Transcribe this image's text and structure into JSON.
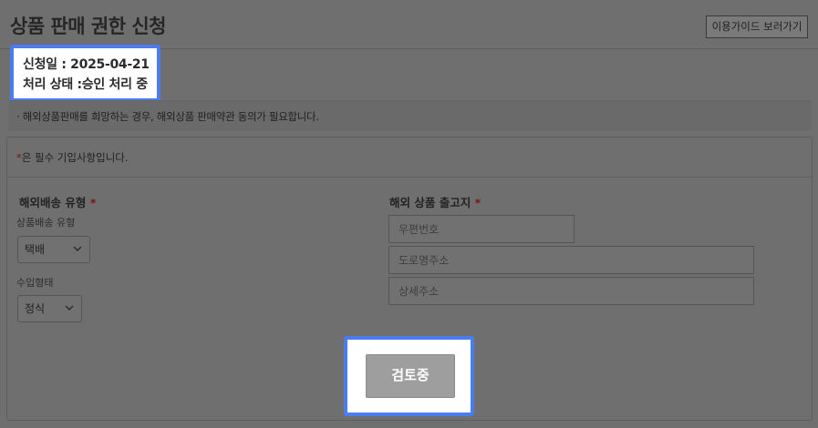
{
  "header": {
    "title": "상품 판매 권한 신청",
    "guide_button_label": "이용가이드 보러가기"
  },
  "status": {
    "apply_date_line": "신청일 : 2025-04-21",
    "process_status_line": "처리 상태 :승인 처리 중"
  },
  "notice": {
    "text": "· 해외상품판매를 희망하는 경우, 해외상품 판매약관 동의가 필요합니다."
  },
  "form": {
    "required_mark": "*",
    "required_text": "은 필수 기입사항입니다.",
    "shipping": {
      "section_title": "해외배송 유형",
      "product_shipping_type_label": "상품배송 유형",
      "product_shipping_type_value": "택배",
      "import_type_label": "수입형태",
      "import_type_value": "정식"
    },
    "warehouse": {
      "section_title": "해외 상품 출고지",
      "postcode_placeholder": "우편번호",
      "road_address_placeholder": "도로명주소",
      "detail_address_placeholder": "상세주소"
    },
    "review_button_label": "검토중"
  },
  "icons": {
    "select_arrow": "chevron-down-icon"
  },
  "colors": {
    "highlight": "#4a7cf0",
    "required_star": "#7a1515",
    "button_gray": "#9e9e9e"
  }
}
